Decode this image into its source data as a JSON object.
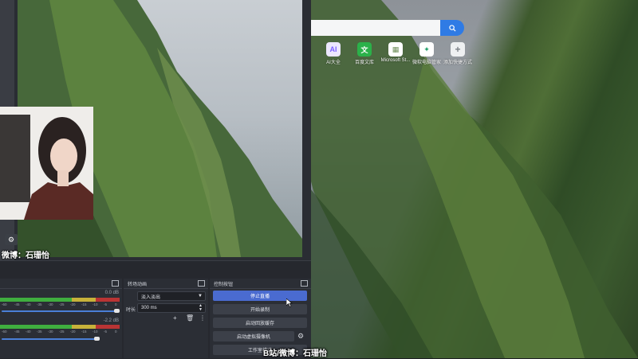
{
  "browser": {
    "shortcuts": [
      {
        "label": "AI大全",
        "icon": "ai-icon",
        "glyph": "AI",
        "color": "#7b61ff"
      },
      {
        "label": "百度文库",
        "icon": "baidu-wenku-icon",
        "glyph": "文",
        "color": "#2bb14a"
      },
      {
        "label": "Microsoft St...",
        "icon": "microsoft-store-icon",
        "glyph": "▦",
        "color": "#9aa0a6"
      },
      {
        "label": "微软电脑管家",
        "icon": "pc-manager-icon",
        "glyph": "✦",
        "color": "#22a06b"
      },
      {
        "label": "添加快捷方式",
        "icon": "add-icon",
        "glyph": "+",
        "color": "#7c8188"
      }
    ]
  },
  "overlay": {
    "preview_caption": "微博：石珊怡",
    "bottom_caption": "B站/微博：石珊怡"
  },
  "audio_mixer": {
    "channels": [
      {
        "db": "0.0 dB",
        "level": 0.0,
        "fader": 1.0
      },
      {
        "db": "-2.2 dB",
        "level": 0.0,
        "fader": 0.8
      }
    ],
    "scale": [
      "-60",
      "-45",
      "-40",
      "-35",
      "-30",
      "-25",
      "-20",
      "-15",
      "-10",
      "-5",
      "0"
    ]
  },
  "transitions": {
    "title": "转场动画",
    "selected": "淡入淡出",
    "duration_label": "时长",
    "duration_value": "300 ms"
  },
  "controls": {
    "title": "控制按钮",
    "buttons": [
      "停止直播",
      "开始录制",
      "启动回放缓存",
      "启动虚拟摄像机",
      "工作室模式"
    ]
  },
  "colors": {
    "accent": "#4a6bd0",
    "meter_green": "#3fae3f",
    "meter_yellow": "#c7b23a",
    "meter_red": "#b93434"
  }
}
